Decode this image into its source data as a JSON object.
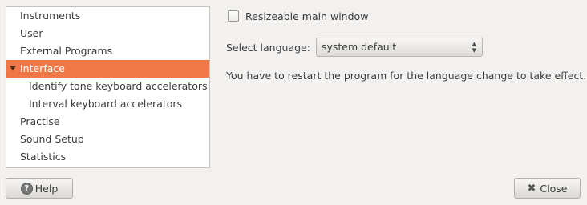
{
  "sidebar": {
    "items": [
      {
        "label": "Instruments"
      },
      {
        "label": "User"
      },
      {
        "label": "External Programs"
      },
      {
        "label": "Interface",
        "selected": true,
        "expanded": true
      },
      {
        "label": "Identify tone keyboard accelerators",
        "child": true
      },
      {
        "label": "Interval keyboard accelerators",
        "child": true
      },
      {
        "label": "Practise"
      },
      {
        "label": "Sound Setup"
      },
      {
        "label": "Statistics"
      }
    ]
  },
  "interface": {
    "resizeable_label": "Resizeable main window",
    "resizeable_checked": false,
    "language_label": "Select language:",
    "language_value": "system default",
    "restart_hint": "You have to restart the program for the language change to take effect."
  },
  "buttons": {
    "help_label": "Help",
    "close_label": "Close"
  },
  "colors": {
    "selection": "#f07746",
    "window_bg": "#f2f1f0"
  }
}
